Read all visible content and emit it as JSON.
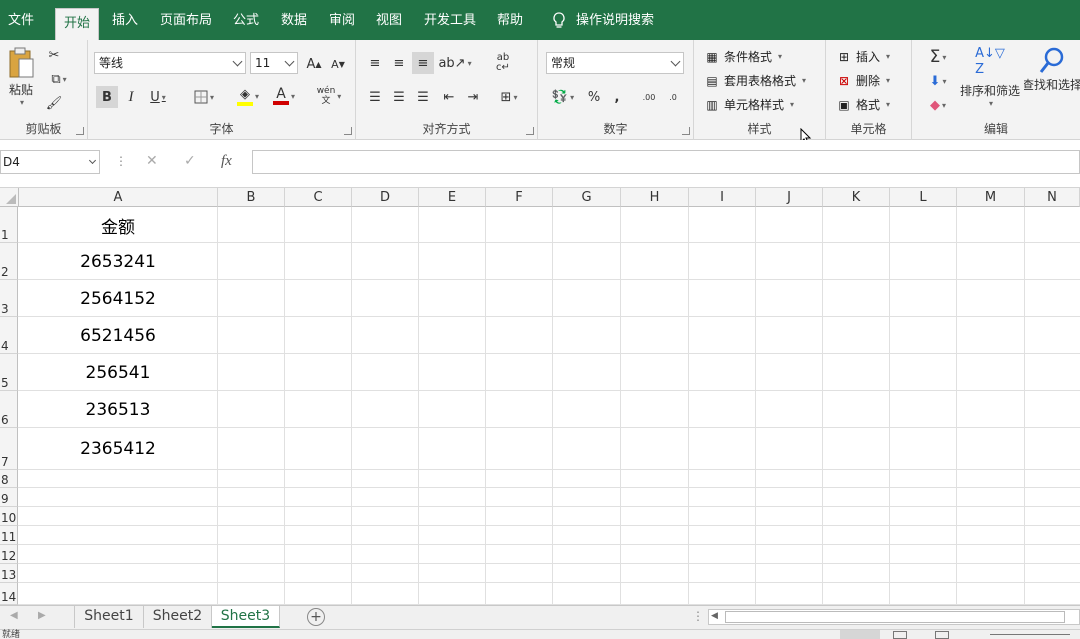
{
  "menu": {
    "tabs": [
      "文件",
      "开始",
      "插入",
      "页面布局",
      "公式",
      "数据",
      "审阅",
      "视图",
      "开发工具",
      "帮助"
    ],
    "search": "操作说明搜索"
  },
  "ribbon": {
    "clipboard": {
      "paste": "粘贴",
      "label": "剪贴板"
    },
    "font": {
      "name": "等线",
      "size": "11",
      "bold": "B",
      "italic": "I",
      "underline": "U",
      "grow": "A",
      "shrink": "A",
      "color_letter": "A",
      "wen": "wén",
      "label": "字体",
      "fill_color": "#ffff00",
      "font_color": "#d00000"
    },
    "alignment": {
      "label": "对齐方式",
      "abc": "ab"
    },
    "number": {
      "format": "常规",
      "percent": "%",
      "comma": ",",
      "inc": ".00",
      "dec": ".0",
      "label": "数字"
    },
    "styles": {
      "cond": "条件格式",
      "table": "套用表格格式",
      "cell": "单元格样式",
      "label": "样式"
    },
    "cells": {
      "insert": "插入",
      "delete": "删除",
      "format": "格式",
      "label": "单元格"
    },
    "editing": {
      "sigma": "Σ",
      "sort": "排序和筛选",
      "find": "查找和选择",
      "label": "编辑"
    }
  },
  "formula_bar": {
    "namebox": "D4",
    "fx": "fx",
    "cancel": "✕",
    "enter": "✓",
    "value": ""
  },
  "grid": {
    "columns": [
      "A",
      "B",
      "C",
      "D",
      "E",
      "F",
      "G",
      "H",
      "I",
      "J",
      "K",
      "L",
      "M",
      "N"
    ],
    "rows": [
      "1",
      "2",
      "3",
      "4",
      "5",
      "6",
      "7",
      "8",
      "9",
      "10",
      "11",
      "12",
      "13",
      "14"
    ],
    "cells": [
      "金额",
      "2653241",
      "2564152",
      "6521456",
      "256541",
      "236513",
      "2365412"
    ]
  },
  "sheets": {
    "tabs": [
      "Sheet1",
      "Sheet2",
      "Sheet3"
    ],
    "active": "Sheet3",
    "add": "+"
  },
  "status": {
    "text": "就绪"
  },
  "colors": {
    "brand": "#217346",
    "ribbon_bg": "#f3f3f3",
    "grid_line": "#e0e0e0"
  }
}
